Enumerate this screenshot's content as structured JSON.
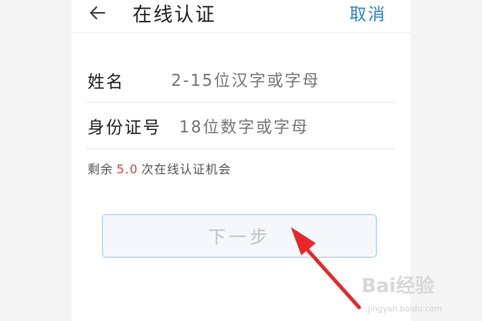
{
  "header": {
    "back_icon": "arrow-left-icon",
    "title": "在线认证",
    "cancel_label": "取消"
  },
  "form": {
    "name": {
      "label": "姓名",
      "placeholder": "2-15位汉字或字母"
    },
    "id_number": {
      "label": "身份证号",
      "placeholder": "18位数字或字母"
    }
  },
  "remaining": {
    "prefix": "剩余",
    "count": "5.0",
    "suffix": "次在线认证机会"
  },
  "next_button": {
    "label": "下一步"
  },
  "annotation": {
    "arrow_color": "#e8262a"
  },
  "watermark": {
    "brand": "Bai经验",
    "url": "jingyan.baidu.com"
  },
  "colors": {
    "accent": "#2f7fd8",
    "count": "#e0453a",
    "placeholder": "#c9c9c9"
  }
}
